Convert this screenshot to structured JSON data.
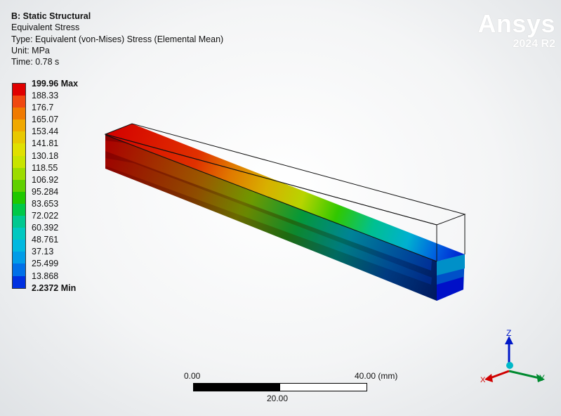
{
  "info": {
    "title": "B: Static Structural",
    "result": "Equivalent Stress",
    "type": "Type: Equivalent (von-Mises) Stress (Elemental Mean)",
    "unit": "Unit: MPa",
    "time": "Time: 0.78 s"
  },
  "legend": {
    "labels": [
      "199.96 Max",
      "188.33",
      "176.7",
      "165.07",
      "153.44",
      "141.81",
      "130.18",
      "118.55",
      "106.92",
      "95.284",
      "83.653",
      "72.022",
      "60.392",
      "48.761",
      "37.13",
      "25.499",
      "13.868",
      "2.2372 Min"
    ],
    "colors": [
      "#e00000",
      "#f04810",
      "#f07a00",
      "#f0a800",
      "#e8c800",
      "#e0e000",
      "#c8e400",
      "#9cdc00",
      "#60d000",
      "#20c800",
      "#00c848",
      "#00c890",
      "#00c8c0",
      "#00b8e0",
      "#009ce8",
      "#0070e8",
      "#0030e0"
    ]
  },
  "brand": {
    "name": "Ansys",
    "version": "2024 R2"
  },
  "scale": {
    "start": "0.00",
    "end": "40.00 (mm)",
    "mid": "20.00"
  },
  "triad": {
    "x": "X",
    "y": "Y",
    "z": "Z"
  }
}
